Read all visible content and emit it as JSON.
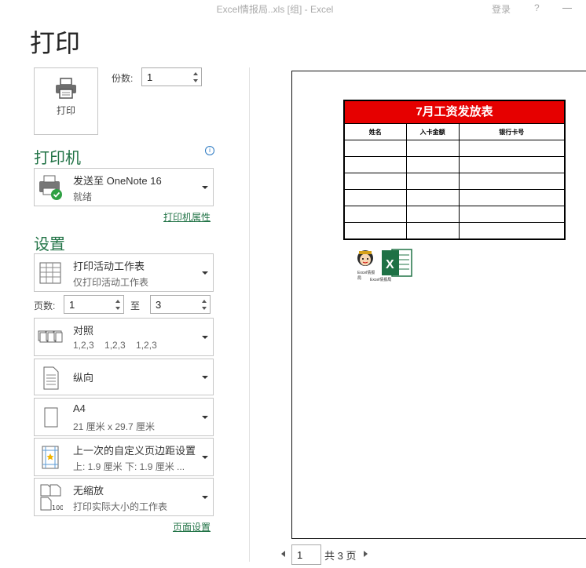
{
  "window": {
    "title": "Excel情报局..xls  [组]  -  Excel",
    "login": "登录",
    "help": "?"
  },
  "page_title": "打印",
  "print_button": {
    "label": "打印",
    "icon": "printer-icon"
  },
  "copies": {
    "label": "份数:",
    "value": "1"
  },
  "printer_section": {
    "title": "打印机",
    "printer": {
      "name": "发送至 OneNote 16",
      "status": "就绪",
      "icon": "printer-ready-icon"
    },
    "properties_link": "打印机属性"
  },
  "settings_section": {
    "title": "设置",
    "scope": {
      "main": "打印活动工作表",
      "sub": "仅打印活动工作表"
    },
    "pages": {
      "label": "页数:",
      "from": "1",
      "to_label": "至",
      "to": "3"
    },
    "collation": {
      "main": "对照",
      "sub": "1,2,3    1,2,3    1,2,3"
    },
    "orientation": {
      "main": "纵向"
    },
    "paper": {
      "main": "A4",
      "sub": "21 厘米 x 29.7 厘米"
    },
    "margins": {
      "main": "上一次的自定义页边距设置",
      "sub": "上: 1.9 厘米 下: 1.9 厘米 ..."
    },
    "scaling": {
      "main": "无缩放",
      "sub": "打印实际大小的工作表",
      "icon_text": "100"
    },
    "page_setup_link": "页面设置"
  },
  "preview": {
    "table_title": "7月工资发放表",
    "headers": [
      "姓名",
      "入卡金额",
      "银行卡号"
    ],
    "empty_rows": 6,
    "logo_caption": "Excel情报局",
    "logo_badge": "Excel情报局",
    "excel_letter": "X"
  },
  "pager": {
    "current": "1",
    "total_text": "共 3 页"
  },
  "colors": {
    "accent": "#217346",
    "table_header_bg": "#e60000"
  }
}
